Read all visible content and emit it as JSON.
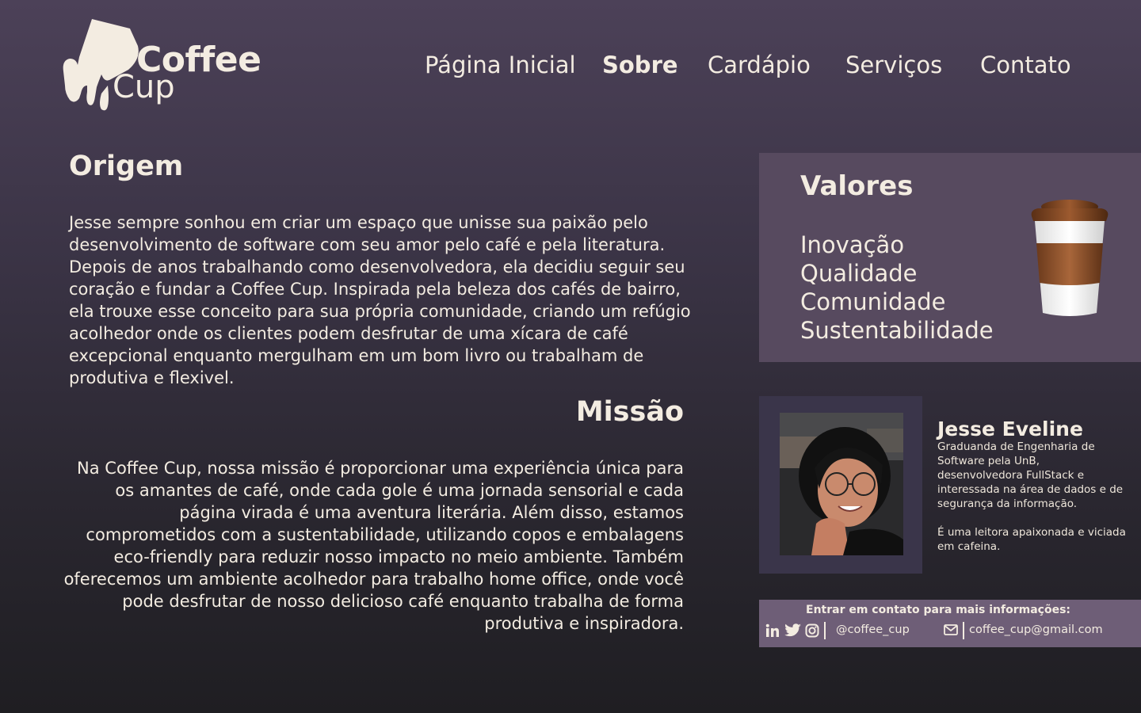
{
  "brand": {
    "name_line1": "Coffee",
    "name_line2": "Cup"
  },
  "nav": {
    "items": [
      {
        "label": "Página Inicial",
        "active": false
      },
      {
        "label": "Sobre",
        "active": true
      },
      {
        "label": "Cardápio",
        "active": false
      },
      {
        "label": "Serviços",
        "active": false
      },
      {
        "label": "Contato",
        "active": false
      }
    ]
  },
  "origem": {
    "title": "Origem",
    "text": "Jesse sempre sonhou em criar um espaço que unisse sua paixão pelo desenvolvimento de software com seu amor pelo café e pela literatura. Depois de anos trabalhando como desenvolvedora, ela decidiu seguir seu coração e fundar a Coffee Cup. Inspirada pela beleza dos cafés de bairro, ela trouxe esse conceito para sua própria comunidade, criando um refúgio acolhedor onde os clientes podem desfrutar de uma xícara de café excepcional enquanto mergulham em um bom livro ou trabalham de produtiva e flexivel."
  },
  "missao": {
    "title": "Missão",
    "text": "Na Coffee Cup, nossa missão é proporcionar uma experiência única para os amantes de café, onde cada gole é uma jornada sensorial e cada página virada é uma aventura literária. Além disso, estamos comprometidos com a sustentabilidade, utilizando copos e embalagens eco-friendly para reduzir nosso impacto no meio ambiente. Também oferecemos um ambiente acolhedor para trabalho home office, onde você pode desfrutar de nosso delicioso café enquanto trabalha de forma produtiva e inspiradora."
  },
  "valores": {
    "title": "Valores",
    "items": [
      "Inovação",
      "Qualidade",
      "Comunidade",
      "Sustentabilidade"
    ]
  },
  "profile": {
    "name": "Jesse Eveline",
    "bio": "Graduanda de Engenharia de Software pela UnB, desenvolvedora FullStack e interessada na área de dados e de segurança da informação.",
    "bio2": "É uma leitora apaixonada e viciada em cafeina."
  },
  "contact": {
    "title": "Entrar em contato para mais informações:",
    "handle": "@coffee_cup",
    "email": "coffee_cup@gmail.com",
    "icons": [
      "linkedin-icon",
      "twitter-icon",
      "instagram-icon",
      "mail-icon"
    ]
  },
  "colors": {
    "text": "#f3ece1",
    "valores_bg": "#574a5f",
    "profile_card_bg": "#3a354a",
    "contact_bg": "#6e5e77"
  }
}
